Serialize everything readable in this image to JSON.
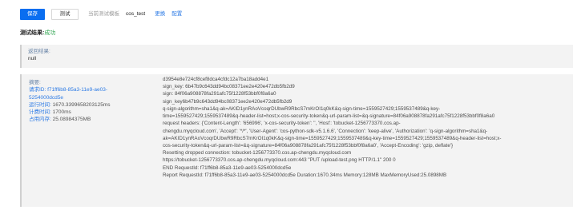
{
  "toolbar": {
    "save_label": "保存",
    "test_label": "测试",
    "env_label": "当前测试模板",
    "env_value": "cos_test",
    "change_label": "更换",
    "config_label": "配置"
  },
  "result": {
    "title": "测试结果:",
    "status": "成功"
  },
  "return_panel": {
    "label": "返回结果:",
    "value": "null"
  },
  "summary": {
    "title": "摘要:",
    "request_id_label": "请求ID:",
    "request_id_value": "f71ff6b8-85a3-11e9-ae03-",
    "request_id_value2": "5254000dcd5e",
    "run_time_label": "运行时间:",
    "run_time_value": "1670.3399658203125ms",
    "billed_time_label": "计费时间:",
    "billed_time_value": "1700ms",
    "memory_label": "占用内存:",
    "memory_value": "25.08984375MB"
  },
  "log_lines": [
    "d3954e8e724cf8cef8dca4cfdc12a7ba18add4e1",
    "sign_key: 6b47b9c643dd94bc08371ee2e420e472db5fb2d9",
    "sign: 84f06a908878fa291afc75f1228f53bbf0f8a6a0",
    "sign_key6b47b9c643dd94bc08371ee2e420e472db5fb2d9",
    "q-sign-algorithm=sha1&q-ak=AKID1ynRAoVcoqrDUbwR9RbcS7mKrOI1q0kK&q-sign-time=1559527429;1559537489&q-key-",
    "time=1559527429;1559537489&q-header-list=host;x-cos-security-token&q-url-param-list=&q-signature=84f06a908878fa291afc75f1228f53bbf0f8a6a0",
    "request headers: {'Content-Length': '656996', 'x-cos-security-token': '', 'Host': 'tobucket-1256773370.cos.ap-",
    "chengdu.myqcloud.com', 'Accept': '*/*', 'User-Agent': 'cos-python-sdk-v5.1.6.6', 'Connection': 'keep-alive', 'Authorization': 'q-sign-algorithm=sha1&q-",
    "ak=AKID1ynRAoVcoqrDUbwR9RbcS7mKrOI1q0kK&q-sign-time=1559527429;1559537489&q-key-time=1559527429;1559537489&q-header-list=host;x-",
    "cos-security-token&q-url-param-list=&q-signature=84f06a908878fa291afc75f1228f53bbf0f8a6a0', 'Accept-Encoding': 'gzip, deflate'}",
    "Resetting dropped connection: tobucket-1256773370.cos.ap-chengdu.myqcloud.com",
    "https://tobucket-1256773370.cos.ap-chengdu.myqcloud.com:443 \"PUT /upload-test.png HTTP/1.1\" 200 0",
    "END RequestId: f71ff6b8-85a3-11e9-ae03-5254000dcd5e",
    "Report RequestId: f71ff6b8-85a3-11e9-ae03-5254000dcd5e Duration:1670.34ms Memory:128MB MaxMemoryUsed:25.0898MB"
  ]
}
